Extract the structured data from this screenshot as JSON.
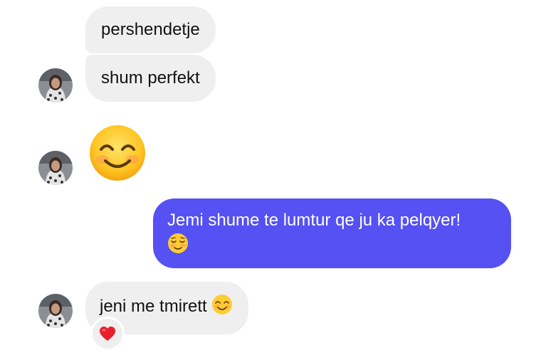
{
  "messages": [
    {
      "direction": "incoming",
      "text": "pershendetje"
    },
    {
      "direction": "incoming",
      "text": "shum perfekt"
    },
    {
      "direction": "incoming",
      "emoji": "smiling-face-with-smiling-eyes"
    },
    {
      "direction": "outgoing",
      "text": "Jemi shume te lumtur qe ju ka pelqyer!",
      "emoji": "relieved-smiling-face"
    },
    {
      "direction": "incoming",
      "text": "jeni me tmirett",
      "emoji": "smiling-face-with-smiling-eyes",
      "reaction": "red-heart"
    }
  ],
  "colors": {
    "incoming_bubble": "#efefef",
    "outgoing_bubble": "#5551f2",
    "outgoing_text": "#ffffff",
    "reaction_heart": "#e8202e"
  }
}
